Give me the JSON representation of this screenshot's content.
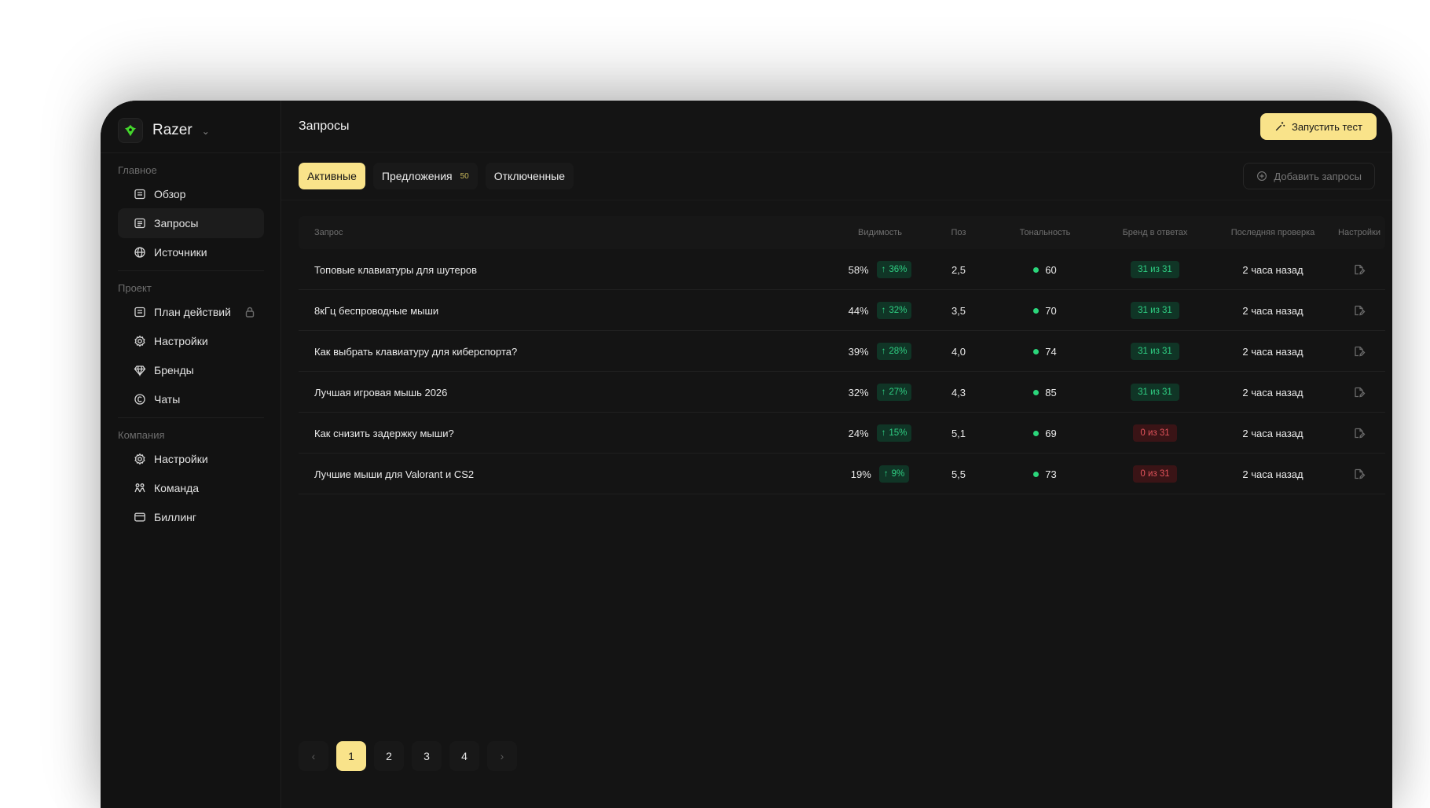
{
  "brand": {
    "name": "Razer"
  },
  "header": {
    "title": "Запросы",
    "run_test_label": "Запустить тест"
  },
  "sidebar": {
    "sections": {
      "main": "Главное",
      "project": "Проект",
      "company": "Компания"
    },
    "items": {
      "overview": "Обзор",
      "queries": "Запросы",
      "sources": "Источники",
      "action_plan": "План действий",
      "project_settings": "Настройки",
      "brands": "Бренды",
      "chats": "Чаты",
      "company_settings": "Настройки",
      "team": "Команда",
      "billing": "Биллинг"
    }
  },
  "tabs": {
    "active": "Активные",
    "suggestions": "Предложения",
    "suggestions_count": "50",
    "disabled": "Отключенные"
  },
  "add_queries_label": "Добавить запросы",
  "table": {
    "columns": {
      "query": "Запрос",
      "visibility": "Видимость",
      "pos": "Поз",
      "tone": "Тональность",
      "brand": "Бренд в ответах",
      "last_check": "Последняя проверка",
      "settings": "Настройки"
    },
    "rows": [
      {
        "query": "Топовые клавиатуры для шутеров",
        "visibility": "58%",
        "delta": "36%",
        "pos": "2,5",
        "tone": "60",
        "brand": "31 из 31",
        "brand_status": "good",
        "last_check": "2 часа назад"
      },
      {
        "query": "8кГц беспроводные мыши",
        "visibility": "44%",
        "delta": "32%",
        "pos": "3,5",
        "tone": "70",
        "brand": "31 из 31",
        "brand_status": "good",
        "last_check": "2 часа назад"
      },
      {
        "query": "Как выбрать клавиатуру для киберспорта?",
        "visibility": "39%",
        "delta": "28%",
        "pos": "4,0",
        "tone": "74",
        "brand": "31 из 31",
        "brand_status": "good",
        "last_check": "2 часа назад"
      },
      {
        "query": "Лучшая игровая мышь 2026",
        "visibility": "32%",
        "delta": "27%",
        "pos": "4,3",
        "tone": "85",
        "brand": "31 из 31",
        "brand_status": "good",
        "last_check": "2 часа назад"
      },
      {
        "query": "Как снизить задержку мыши?",
        "visibility": "24%",
        "delta": "15%",
        "pos": "5,1",
        "tone": "69",
        "brand": "0 из 31",
        "brand_status": "bad",
        "last_check": "2 часа назад"
      },
      {
        "query": "Лучшие мыши для Valorant и CS2",
        "visibility": "19%",
        "delta": "9%",
        "pos": "5,5",
        "tone": "73",
        "brand": "0 из 31",
        "brand_status": "bad",
        "last_check": "2 часа назад"
      }
    ]
  },
  "pagination": {
    "prev": "‹",
    "next": "›",
    "pages": [
      "1",
      "2",
      "3",
      "4"
    ],
    "current": "1"
  },
  "colors": {
    "accent": "#f9e38a",
    "positive": "#2fcf83",
    "negative": "#e0525a",
    "background": "#141414"
  }
}
